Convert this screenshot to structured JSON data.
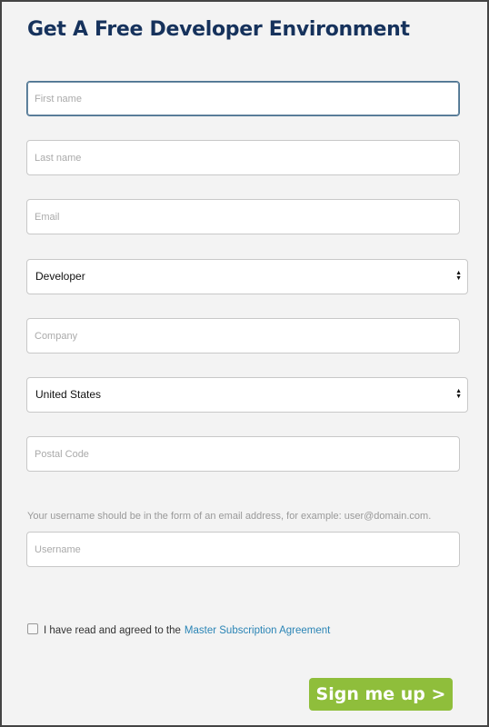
{
  "title": "Get A Free Developer Environment",
  "fields": {
    "first_name": {
      "placeholder": "First name",
      "value": ""
    },
    "last_name": {
      "placeholder": "Last name",
      "value": ""
    },
    "email": {
      "placeholder": "Email",
      "value": ""
    },
    "role": {
      "selected": "Developer"
    },
    "company": {
      "placeholder": "Company",
      "value": ""
    },
    "country": {
      "selected": "United States"
    },
    "postal_code": {
      "placeholder": "Postal Code",
      "value": ""
    },
    "username_help": "Your username should be in the form of an email address, for example: user@domain.com.",
    "username": {
      "placeholder": "Username",
      "value": ""
    }
  },
  "agreement": {
    "text": "I have read and agreed to the",
    "link": "Master Subscription Agreement",
    "checked": false
  },
  "submit_label": "Sign me up >",
  "colors": {
    "heading": "#16325c",
    "link": "#2a84b5",
    "button": "#8fbe3b"
  }
}
